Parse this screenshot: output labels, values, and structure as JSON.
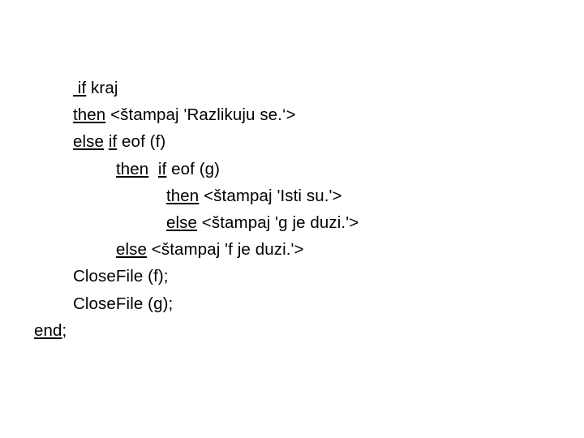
{
  "slide": {
    "background_color": "#ffffff",
    "text_color": "#000000",
    "code": {
      "lines": [
        {
          "indent_level": 1,
          "segments": [
            {
              "text": " if",
              "keyword": true
            },
            {
              "text": " kraj",
              "keyword": false
            }
          ]
        },
        {
          "indent_level": 1,
          "segments": [
            {
              "text": "then",
              "keyword": true
            },
            {
              "text": " <štampaj 'Razlikuju se.‘>",
              "keyword": false
            }
          ]
        },
        {
          "indent_level": 1,
          "segments": [
            {
              "text": "else",
              "keyword": true
            },
            {
              "text": " ",
              "keyword": false
            },
            {
              "text": "if",
              "keyword": true
            },
            {
              "text": " eof (f)",
              "keyword": false
            }
          ]
        },
        {
          "indent_level": 2,
          "segments": [
            {
              "text": "then",
              "keyword": true
            },
            {
              "text": "  ",
              "keyword": false
            },
            {
              "text": "if",
              "keyword": true
            },
            {
              "text": " eof (g)",
              "keyword": false
            }
          ]
        },
        {
          "indent_level": 3,
          "segments": [
            {
              "text": "then",
              "keyword": true
            },
            {
              "text": " <štampaj 'Isti su.'>",
              "keyword": false
            }
          ]
        },
        {
          "indent_level": 3,
          "segments": [
            {
              "text": "else",
              "keyword": true
            },
            {
              "text": " <štampaj 'g je duzi.'>",
              "keyword": false
            }
          ]
        },
        {
          "indent_level": 2,
          "segments": [
            {
              "text": "else",
              "keyword": true
            },
            {
              "text": " <štampaj 'f je duzi.'>",
              "keyword": false
            }
          ]
        },
        {
          "indent_level": 1,
          "segments": [
            {
              "text": "CloseFile (f);",
              "keyword": false
            }
          ]
        },
        {
          "indent_level": 1,
          "segments": [
            {
              "text": "CloseFile (g);",
              "keyword": false
            }
          ]
        },
        {
          "indent_level": 0,
          "segments": [
            {
              "text": "end",
              "keyword": true
            },
            {
              "text": ";",
              "keyword": false
            }
          ]
        }
      ]
    }
  }
}
